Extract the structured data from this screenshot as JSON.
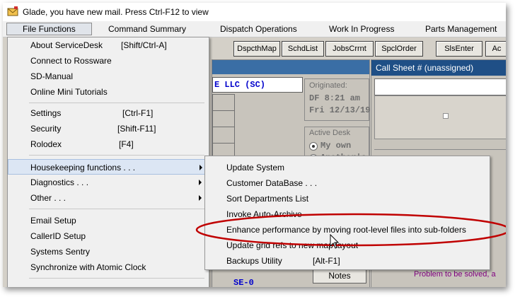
{
  "window": {
    "title": "Glade, you have new mail.  Press Ctrl-F12 to view"
  },
  "menubar": {
    "items": [
      "File Functions",
      "Command Summary",
      "Dispatch Operations",
      "Work In Progress",
      "Parts Management"
    ]
  },
  "toolbar": {
    "buttons": [
      "DspcthMap",
      "SchdList",
      "JobsCrrnt",
      "SpclOrder",
      "SlsEnter",
      "Ac"
    ]
  },
  "file_menu": {
    "items": [
      {
        "label": "About ServiceDesk",
        "shortcut": "[Shift/Ctrl-A]"
      },
      {
        "label": "Connect to Rossware",
        "shortcut": ""
      },
      {
        "label": "SD-Manual",
        "shortcut": ""
      },
      {
        "label": "Online Mini Tutorials",
        "shortcut": ""
      },
      {
        "label": "Settings",
        "shortcut": "[Ctrl-F1]"
      },
      {
        "label": "Security",
        "shortcut": "[Shift-F11]"
      },
      {
        "label": "Rolodex",
        "shortcut": "[F4]"
      },
      {
        "label": "Housekeeping functions . . .",
        "shortcut": ""
      },
      {
        "label": "Diagnostics . . .",
        "shortcut": ""
      },
      {
        "label": "Other . . .",
        "shortcut": ""
      },
      {
        "label": "Email Setup",
        "shortcut": ""
      },
      {
        "label": "CallerID Setup",
        "shortcut": ""
      },
      {
        "label": "Systems Sentry",
        "shortcut": ""
      },
      {
        "label": "Synchronize with Atomic Clock",
        "shortcut": ""
      }
    ]
  },
  "housekeeping_menu": {
    "items": [
      {
        "label": "Update System",
        "shortcut": ""
      },
      {
        "label": "Customer DataBase . . .",
        "shortcut": ""
      },
      {
        "label": "Sort Departments List",
        "shortcut": ""
      },
      {
        "label": "Invoke Auto-Archive",
        "shortcut": ""
      },
      {
        "label": "Enhance performance by moving root-level files into sub-folders",
        "shortcut": ""
      },
      {
        "label": "Update grid refs to new map layout",
        "shortcut": ""
      },
      {
        "label": "Backups Utility",
        "shortcut": "[Alt-F1]"
      }
    ]
  },
  "background": {
    "company_fragment": "E LLC (SC)",
    "originated_label": "Originated:",
    "originated_time": "DF 8:21 am",
    "originated_date": "Fri 12/13/19",
    "active_desk_label": "Active Desk",
    "radio_my_own": "My own",
    "radio_anothers": "Another's",
    "notes_button": "Notes",
    "bottom_fragment": "SE-0",
    "callsheet_title": "Call Sheet # (unassigned)",
    "problem_text": "Problem to be solved, a"
  },
  "colors": {
    "highlight_ellipse": "#c00000",
    "company_text": "#0000cc",
    "callsheet_header": "#1f4f86"
  }
}
